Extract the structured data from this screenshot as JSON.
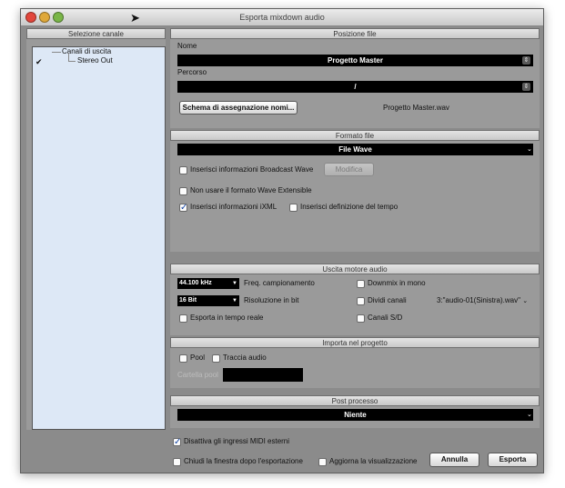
{
  "window": {
    "title": "Esporta mixdown audio"
  },
  "left_panel": {
    "header": "Selezione canale",
    "tree": {
      "parent": "Canali di uscita",
      "child": "Stereo Out"
    }
  },
  "posizione_file": {
    "header": "Posizione file",
    "nome_label": "Nome",
    "nome_value": "Progetto Master",
    "percorso_label": "Percorso",
    "percorso_value": "/",
    "schema_button": "Schema di assegnazione nomi...",
    "filename_preview": "Progetto Master.wav"
  },
  "formato_file": {
    "header": "Formato file",
    "format_value": "File Wave",
    "broadcast_label": "Inserisci informazioni Broadcast Wave",
    "modifica_button": "Modifica",
    "extensible_label": "Non usare il formato Wave Extensible",
    "ixml_label": "Inserisci informazioni iXML",
    "tempo_label": "Inserisci definizione del tempo"
  },
  "uscita_motore": {
    "header": "Uscita motore audio",
    "sample_rate_value": "44.100 kHz",
    "sample_rate_label": "Freq. campionamento",
    "downmix_label": "Downmix in mono",
    "bit_value": "16 Bit",
    "bit_label": "Risoluzione in bit",
    "dividi_label": "Dividi canali",
    "split_name_value": "3:\"audio-01(Sinistra).wav\"",
    "realtime_label": "Esporta in tempo reale",
    "sd_label": "Canali S/D"
  },
  "importa": {
    "header": "Importa nel progetto",
    "pool_label": "Pool",
    "traccia_label": "Traccia audio",
    "cartella_label": "Cartella pool"
  },
  "post_processo": {
    "header": "Post processo",
    "value": "Niente"
  },
  "bottom": {
    "midi_label": "Disattiva gli ingressi MIDI esterni",
    "chiudi_label": "Chiudi la finestra dopo l'esportazione",
    "aggiorna_label": "Aggiorna la visualizzazione",
    "annulla_button": "Annulla",
    "esporta_button": "Esporta"
  },
  "checkbox_states": {
    "stereo_out": true,
    "broadcast": false,
    "extensible": false,
    "ixml": true,
    "tempo": false,
    "downmix": false,
    "dividi": false,
    "realtime": false,
    "sd": false,
    "pool": false,
    "traccia": false,
    "midi": true,
    "chiudi": false,
    "aggiorna": false
  },
  "colors": {
    "close": "#e2463b",
    "minimize": "#dfa83a",
    "zoom": "#7ab648"
  },
  "icons": {
    "check": "✓",
    "mouse_cursor": "arrow-cursor",
    "spin": "up-down-arrows",
    "dropdown": "chevron-down"
  }
}
